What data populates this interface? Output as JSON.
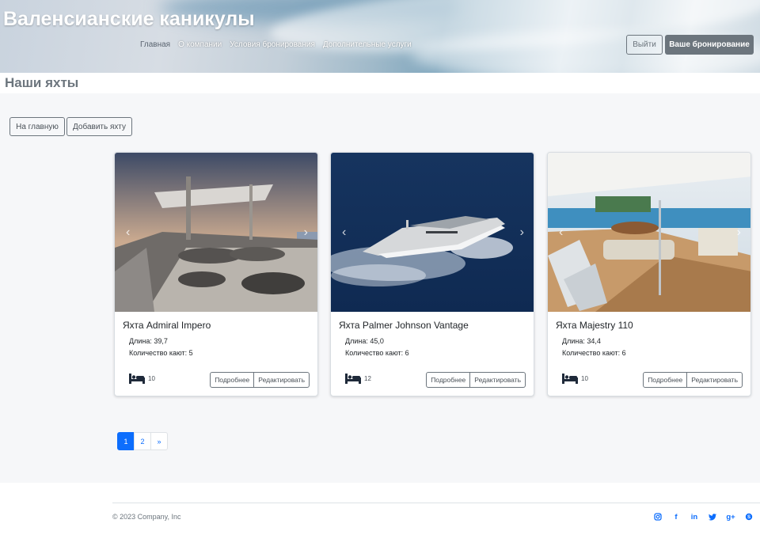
{
  "header": {
    "site_title": "Валенсианские каникулы",
    "nav": [
      "Главная",
      "О компании",
      "Условия бронирования",
      "Дополнительные услуги"
    ],
    "active_nav": "Главная",
    "logout_label": "Выйти",
    "booking_label": "Ваше бронирование"
  },
  "page": {
    "heading": "Наши яхты",
    "home_button": "На главную",
    "add_yacht_button": "Добавить яхту"
  },
  "yachts": [
    {
      "title": "Яхта Admiral Impero",
      "length_text": "Длина: 39,7",
      "cabins_text": "Количество кают: 5",
      "berths": "10",
      "details_label": "Подробнее",
      "edit_label": "Редактировать"
    },
    {
      "title": "Яхта Palmer Johnson Vantage",
      "length_text": "Длина: 45,0",
      "cabins_text": "Количество кают: 6",
      "berths": "12",
      "details_label": "Подробнее",
      "edit_label": "Редактировать"
    },
    {
      "title": "Яхта Majestry 110",
      "length_text": "Длина: 34,4",
      "cabins_text": "Количество кают: 6",
      "berths": "10",
      "details_label": "Подробнее",
      "edit_label": "Редактировать"
    }
  ],
  "pagination": {
    "pages": [
      "1",
      "2"
    ],
    "next": "»",
    "current": "1"
  },
  "footer": {
    "copyright": "© 2023 Company, Inc",
    "social_icons": [
      "instagram-icon",
      "facebook-icon",
      "linkedin-icon",
      "twitter-icon",
      "google-plus-icon",
      "skype-icon"
    ]
  },
  "colors": {
    "primary": "#0d6efd",
    "secondary": "#6c757d",
    "background": "#f6f7f9"
  }
}
